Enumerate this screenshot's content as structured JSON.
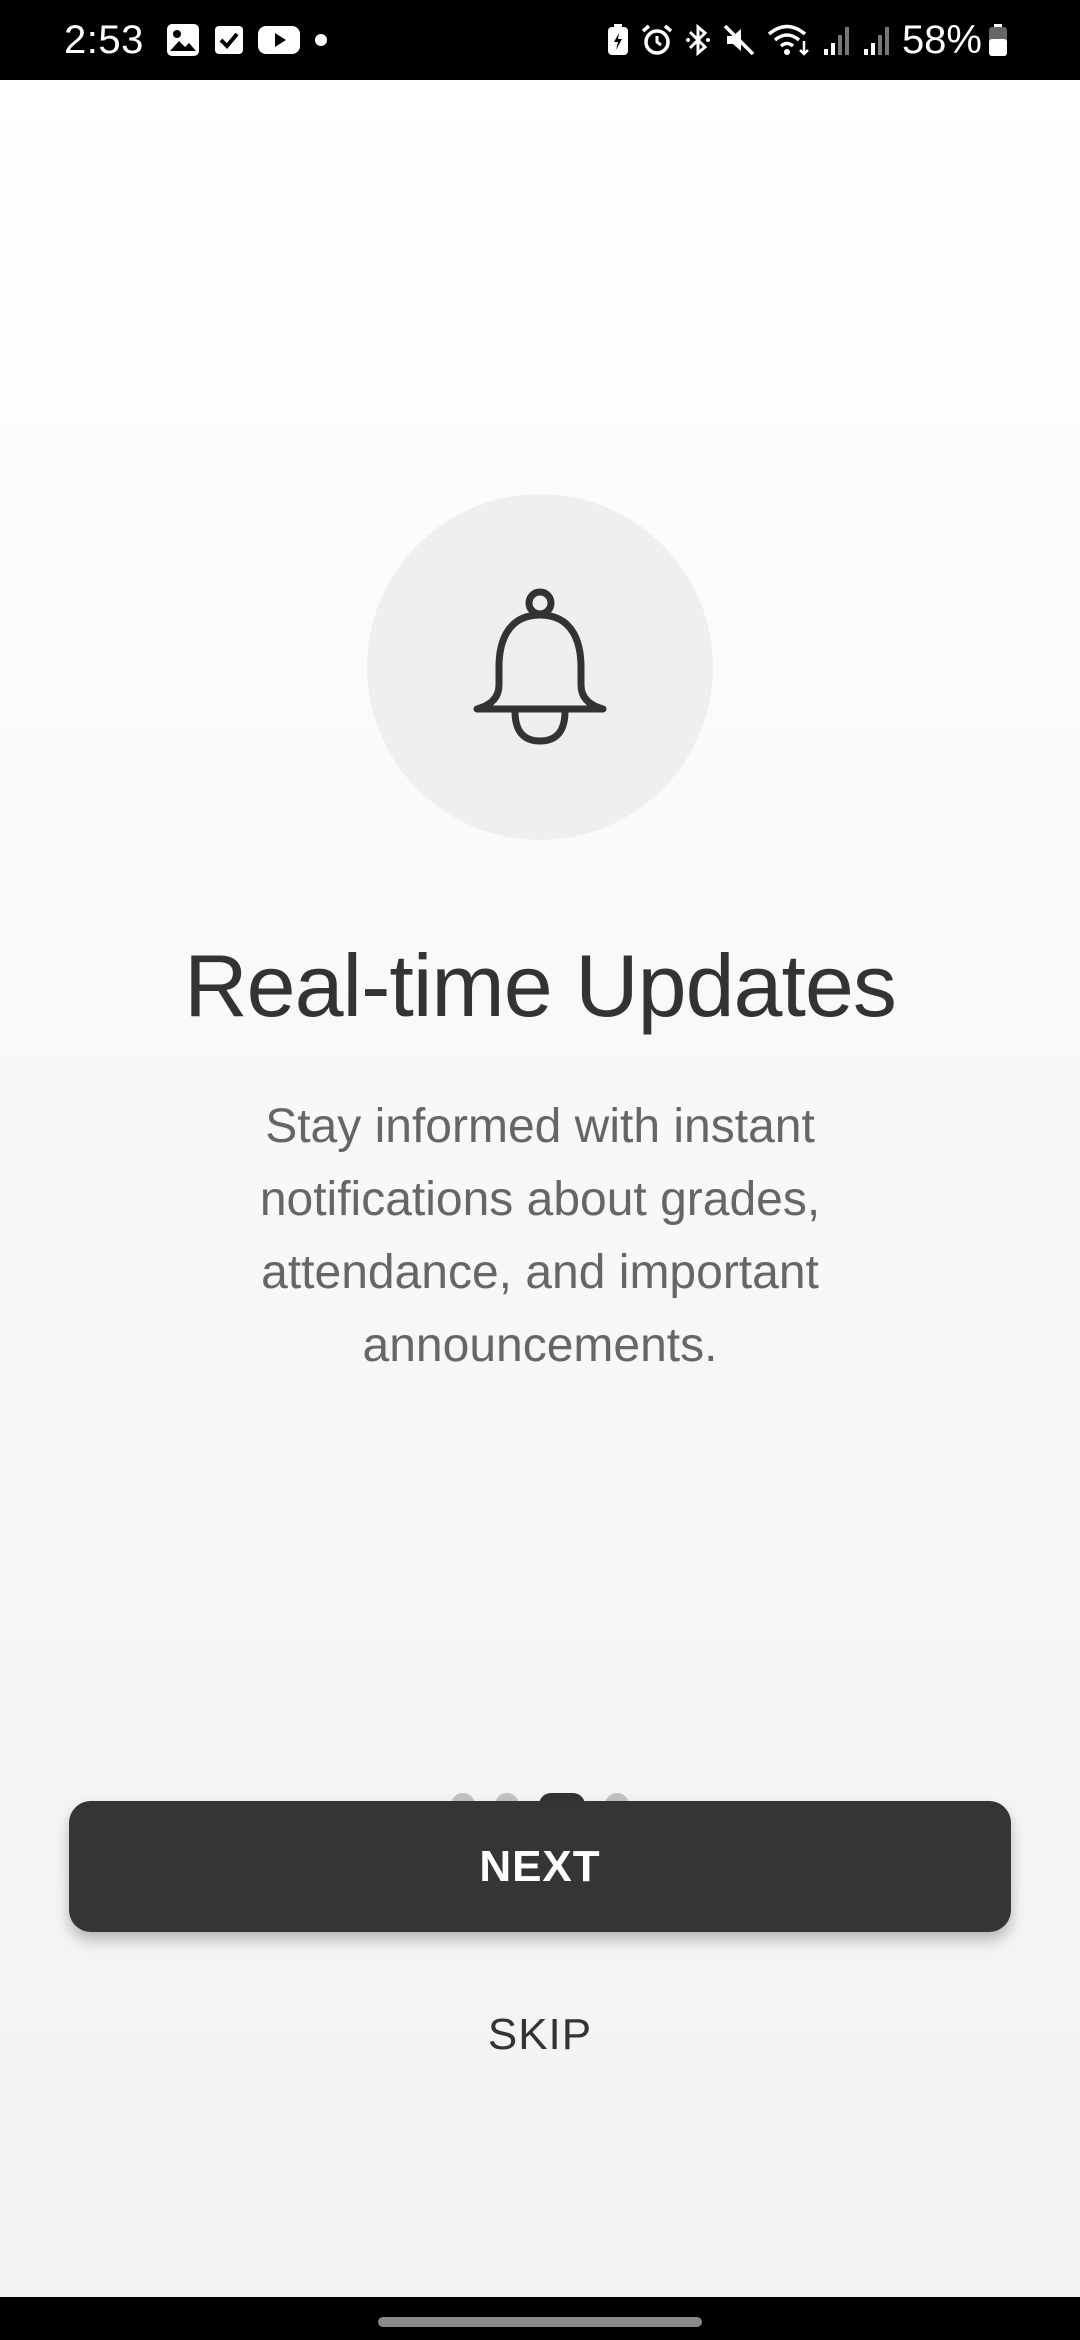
{
  "status_bar": {
    "time": "2:53",
    "battery_percent": "58%",
    "left_icons": [
      "gallery-icon",
      "checkbox-icon",
      "youtube-icon",
      "dot-icon"
    ],
    "right_icons": [
      "battery-saver-icon",
      "alarm-icon",
      "bluetooth-icon",
      "mute-icon",
      "wifi-icon",
      "signal-icon",
      "signal-icon",
      "battery-icon"
    ]
  },
  "onboarding": {
    "icon": "bell-icon",
    "title": "Real-time Updates",
    "description": "Stay informed with instant notifications about grades, attendance, and important announcements.",
    "page_indicator": {
      "total": 4,
      "current": 3
    },
    "next_label": "NEXT",
    "skip_label": "SKIP"
  },
  "colors": {
    "button_bg": "#353535",
    "title_text": "#333333",
    "body_text": "#666666",
    "circle_bg": "#efefef"
  }
}
